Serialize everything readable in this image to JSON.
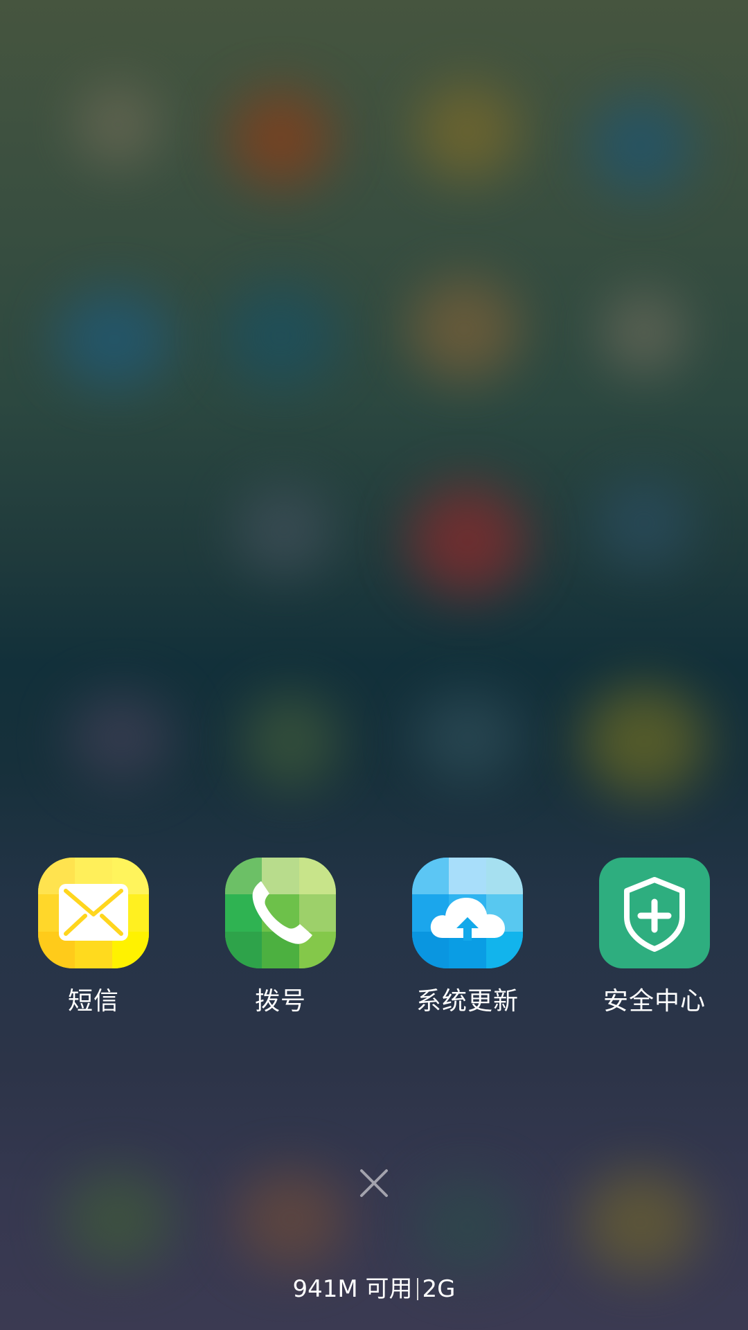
{
  "recent_apps": [
    {
      "label": "短信",
      "icon": "envelope-icon"
    },
    {
      "label": "拨号",
      "icon": "phone-handset-icon"
    },
    {
      "label": "系统更新",
      "icon": "cloud-upload-icon"
    },
    {
      "label": "安全中心",
      "icon": "shield-plus-icon"
    }
  ],
  "close": {
    "icon": "close-icon"
  },
  "memory": {
    "available": "941M 可用",
    "total": "2G"
  },
  "colors": {
    "sms": "#FFE11A",
    "dialer": "#4CB848",
    "update": "#12A9EA",
    "security": "#2EAE7F"
  }
}
